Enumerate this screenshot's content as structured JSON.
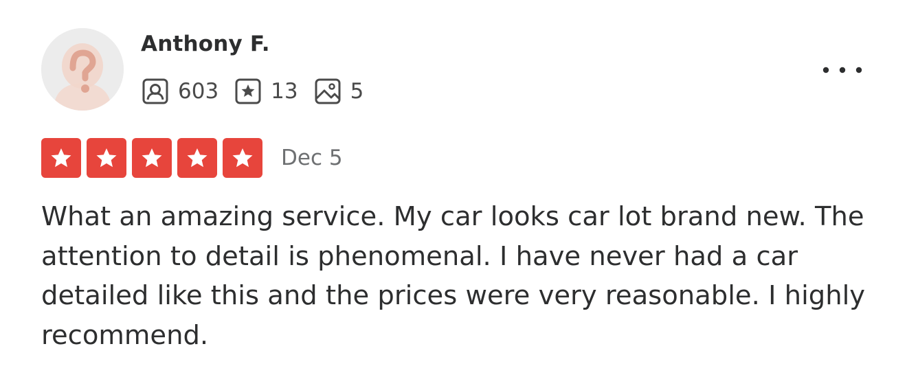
{
  "review": {
    "user": {
      "name": "Anthony F.",
      "avatar_icon": "question-mark-avatar-icon"
    },
    "stats": {
      "friends": {
        "icon": "friends-icon",
        "count": "603"
      },
      "reviews": {
        "icon": "star-review-icon",
        "count": "13"
      },
      "photos": {
        "icon": "photo-icon",
        "count": "5"
      }
    },
    "more_icon": "more-dots-icon",
    "rating": {
      "stars": 5,
      "max": 5,
      "color": "#e7453c"
    },
    "date": "Dec 5",
    "text": "What an amazing service. My car looks car lot brand new. The attention to detail is phenomenal. I have never had a car detailed like this and the prices were very reasonable. I highly recommend."
  }
}
